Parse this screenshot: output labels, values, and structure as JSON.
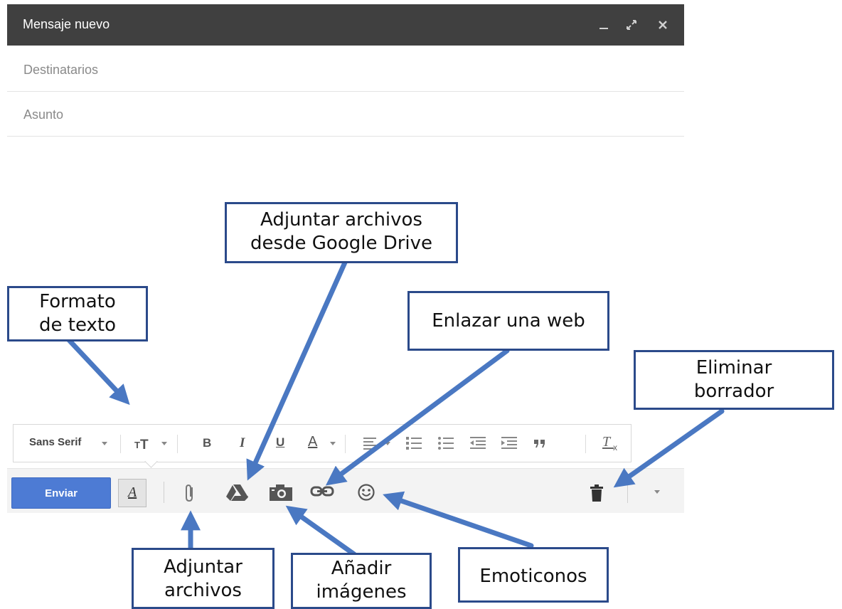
{
  "compose": {
    "title": "Mensaje nuevo",
    "to_placeholder": "Destinatarios",
    "subject_placeholder": "Asunto",
    "controls": [
      "minimize-icon",
      "expand-icon",
      "close-icon"
    ]
  },
  "format_toolbar": {
    "font": "Sans Serif",
    "size_icon": "text-size-icon",
    "bold": "B",
    "italic": "I",
    "underline": "U",
    "text_color": "A"
  },
  "actions": {
    "send_label": "Enviar",
    "format_toggle_label": "A"
  },
  "annotations": {
    "drive": [
      "Adjuntar archivos",
      "desde Google Drive"
    ],
    "format": [
      "Formato",
      "de texto"
    ],
    "link": "Enlazar una web",
    "delete": [
      "Eliminar",
      "borrador"
    ],
    "attach": [
      "Adjuntar",
      "archivos"
    ],
    "images": [
      "Añadir",
      "imágenes"
    ],
    "emoji": "Emoticonos"
  },
  "colors": {
    "titlebar": "#404040",
    "send_button": "#4d7bd4",
    "arrow": "#4a78c2",
    "callout_border": "#2b4a8a"
  }
}
